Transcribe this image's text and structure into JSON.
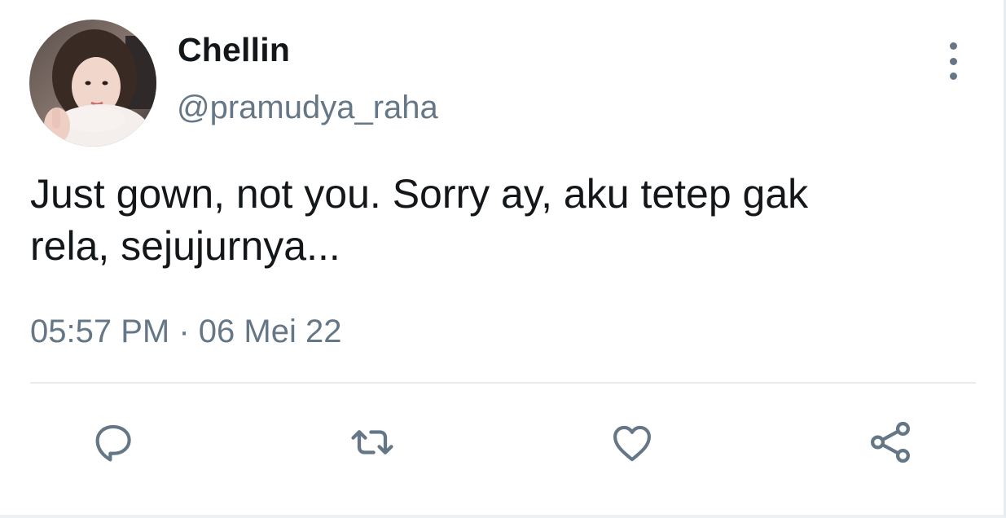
{
  "tweet": {
    "display_name": "Chellin",
    "handle": "@pramudya_raha",
    "text_line1": "Just gown, not you. Sorry ay, aku tetep gak",
    "text_line2": "rela, sejujurnya...",
    "time": "05:57 PM",
    "separator": "·",
    "date": "06 Mei 22"
  },
  "icons": {
    "reply": "speech-bubble-icon",
    "retweet": "retweet-arrows-icon",
    "like": "heart-icon",
    "share": "share-nodes-icon",
    "more": "vertical-dots-icon"
  },
  "colors": {
    "text_primary": "#14171a",
    "text_secondary": "#657786",
    "divider": "#e6ecf0"
  }
}
